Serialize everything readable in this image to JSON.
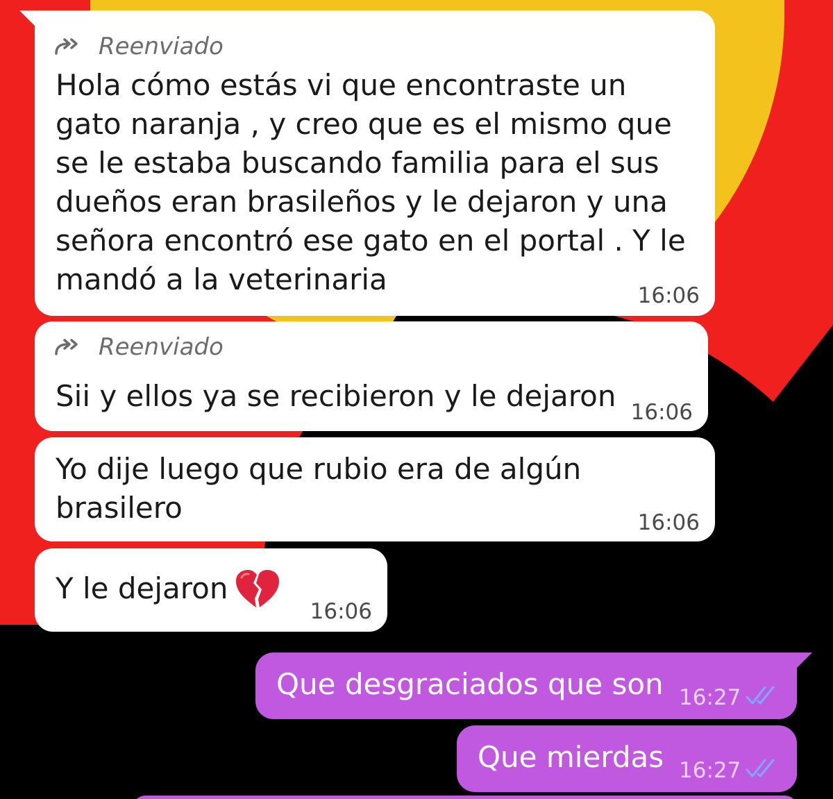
{
  "chat": {
    "messages": [
      {
        "direction": "incoming",
        "forwarded_label": "Reenviado",
        "lines": [
          "Hola cómo estás vi que encontraste un",
          "gato naranja , y creo que es el mismo que",
          "se le estaba buscando familia para el sus",
          "dueños eran brasileños y le dejaron y una",
          "señora encontró ese gato en el portal . Y le",
          "mandó a la veterinaria"
        ],
        "time": "16:06"
      },
      {
        "direction": "incoming",
        "forwarded_label": "Reenviado",
        "text": "Sii y ellos ya se recibieron y le dejaron",
        "time": "16:06"
      },
      {
        "direction": "incoming",
        "lines": [
          "Yo dije luego que rubio era de algún",
          "brasilero"
        ],
        "time": "16:06"
      },
      {
        "direction": "incoming",
        "text": "Y le dejaron",
        "emoji": "broken-heart",
        "time": "16:06"
      },
      {
        "direction": "outgoing",
        "text": "Que desgraciados que son",
        "time": "16:27",
        "status": "read"
      },
      {
        "direction": "outgoing",
        "text": "Que mierdas",
        "time": "16:27",
        "status": "read"
      }
    ]
  },
  "colors": {
    "incoming_bubble": "#ffffff",
    "outgoing_bubble": "#c059df",
    "read_ticks": "#7fa8ff",
    "wallpaper_red": "#f0201e",
    "wallpaper_yellow": "#f4c21c"
  },
  "icons": {
    "forward": "forward-arrow-icon",
    "read_status": "double-check-icon",
    "emoji": "broken-heart-emoji"
  }
}
